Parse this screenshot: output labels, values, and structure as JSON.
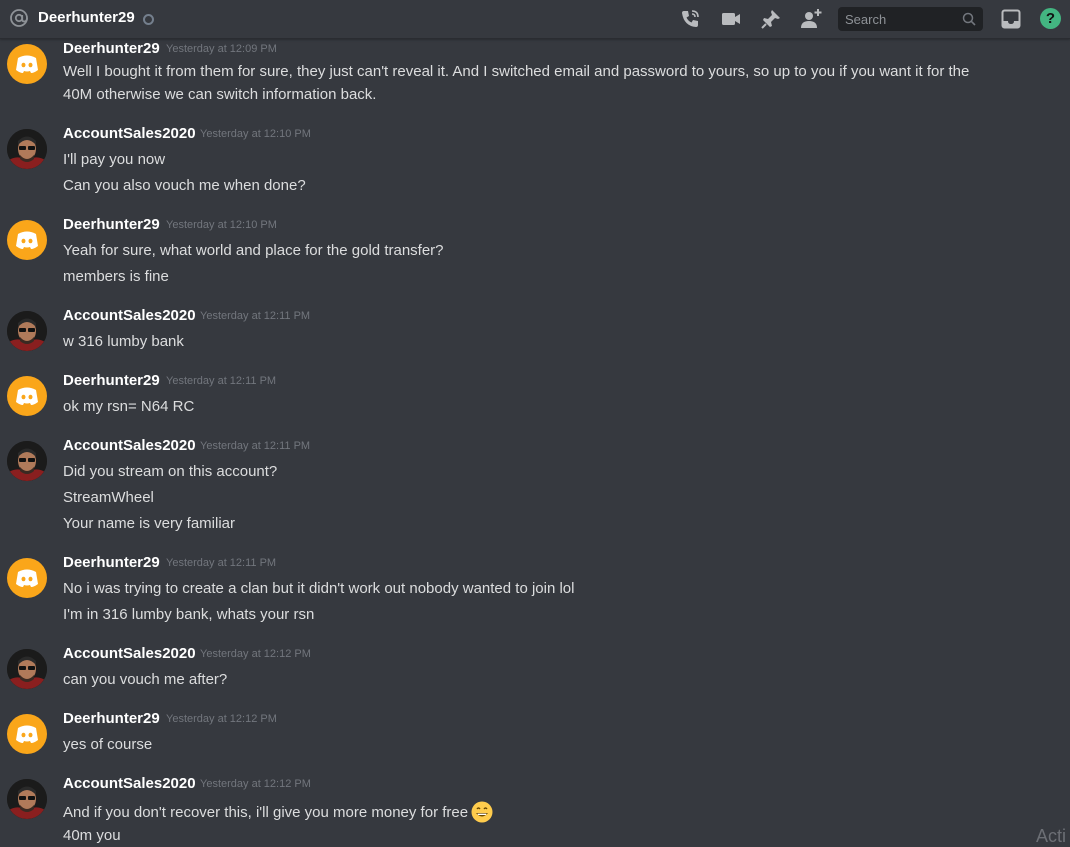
{
  "header": {
    "title": "Deerhunter29",
    "search_placeholder": "Search",
    "help_label": "?",
    "icons": [
      "at-icon",
      "call-icon",
      "video-icon",
      "pin-icon",
      "add-friend-icon",
      "search-icon",
      "inbox-icon",
      "help-icon"
    ]
  },
  "colors": {
    "accent_yellow": "#faa61a",
    "online_green": "#43b581",
    "background": "#36393f"
  },
  "messages": [
    {
      "author": "Deerhunter29",
      "timestamp": "Yesterday at 12:09 PM",
      "lines": [
        "Well I bought it from them for sure, they just can't reveal it. And I switched email and password to yours, so up to you if you want it for the",
        "40M otherwise we can switch information back."
      ]
    },
    {
      "author": "AccountSales2020",
      "timestamp": "Yesterday at 12:10 PM",
      "lines": [
        "I'll pay you now",
        "Can you also vouch me when done?"
      ]
    },
    {
      "author": "Deerhunter29",
      "timestamp": "Yesterday at 12:10 PM",
      "lines": [
        "Yeah for sure, what world and place for the gold transfer?",
        "members is fine"
      ]
    },
    {
      "author": "AccountSales2020",
      "timestamp": "Yesterday at 12:11 PM",
      "lines": [
        "w 316 lumby bank"
      ]
    },
    {
      "author": "Deerhunter29",
      "timestamp": "Yesterday at 12:11 PM",
      "lines": [
        "ok my rsn= N64 RC"
      ]
    },
    {
      "author": "AccountSales2020",
      "timestamp": "Yesterday at 12:11 PM",
      "lines": [
        "Did you stream on this account?",
        "StreamWheel",
        "Your name is very familiar"
      ]
    },
    {
      "author": "Deerhunter29",
      "timestamp": "Yesterday at 12:11 PM",
      "lines": [
        "No i was trying to create a clan but it didn't work out nobody wanted to join lol",
        "I'm in 316 lumby bank, whats your rsn"
      ]
    },
    {
      "author": "AccountSales2020",
      "timestamp": "Yesterday at 12:12 PM",
      "lines": [
        "can you vouch me after?"
      ]
    },
    {
      "author": "Deerhunter29",
      "timestamp": "Yesterday at 12:12 PM",
      "lines": [
        "yes of course"
      ]
    },
    {
      "author": "AccountSales2020",
      "timestamp": "Yesterday at 12:12 PM",
      "lines": [
        "And if you don't recover this, i'll give you more money for free",
        "40m you"
      ],
      "emoji": "grinning-face-emoji"
    }
  ],
  "watermark": "Acti"
}
